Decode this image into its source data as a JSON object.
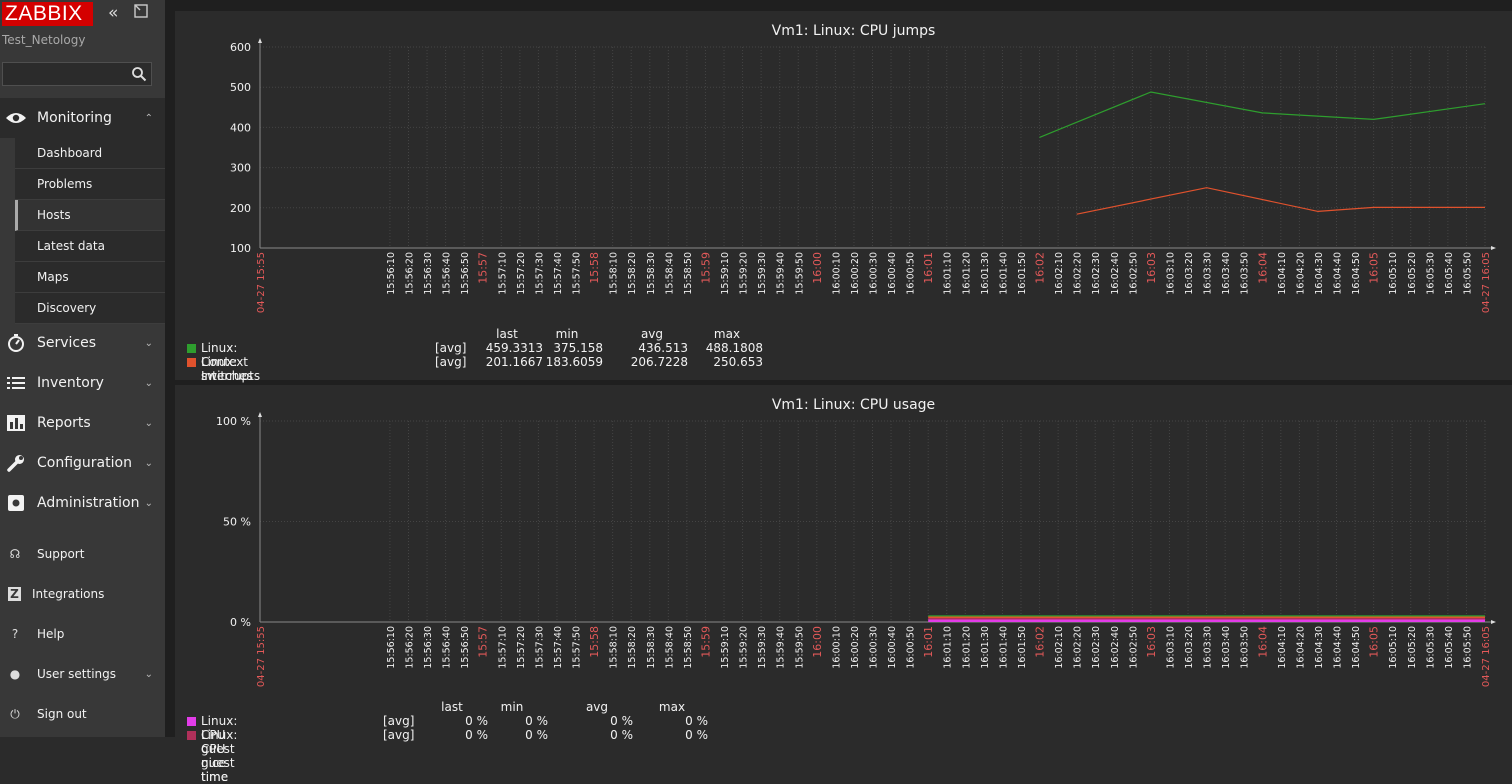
{
  "app": {
    "logo": "ZABBIX",
    "server_name": "Test_Netology",
    "search_placeholder": ""
  },
  "sidebar": {
    "monitoring": {
      "label": "Monitoring",
      "icon": "eye-icon"
    },
    "submenu": [
      {
        "label": "Dashboard",
        "active": false
      },
      {
        "label": "Problems",
        "active": false
      },
      {
        "label": "Hosts",
        "active": true
      },
      {
        "label": "Latest data",
        "active": false
      },
      {
        "label": "Maps",
        "active": false
      },
      {
        "label": "Discovery",
        "active": false
      }
    ],
    "sections": [
      {
        "label": "Services",
        "icon": "stopwatch-icon"
      },
      {
        "label": "Inventory",
        "icon": "list-icon"
      },
      {
        "label": "Reports",
        "icon": "bar-chart-icon"
      },
      {
        "label": "Configuration",
        "icon": "wrench-icon"
      },
      {
        "label": "Administration",
        "icon": "gear-icon"
      }
    ],
    "bottom": [
      {
        "label": "Support",
        "icon": "headset-icon",
        "glyph": "☊"
      },
      {
        "label": "Integrations",
        "icon": "z-icon",
        "glyph": "Z"
      },
      {
        "label": "Help",
        "icon": "question-icon",
        "glyph": "?"
      },
      {
        "label": "User settings",
        "icon": "user-icon",
        "glyph": "●"
      },
      {
        "label": "Sign out",
        "icon": "power-icon",
        "glyph": "⏻"
      }
    ]
  },
  "colors": {
    "accent_red": "#d40000",
    "time_label_red": "#e45959",
    "series_green": "#2e9e2e",
    "series_orange": "#e0522d",
    "series_magenta": "#e23ce8"
  },
  "chart_data": [
    {
      "type": "line",
      "title": "Vm1: Linux: CPU jumps",
      "ylim": [
        100,
        600
      ],
      "y_ticks": [
        "600",
        "500",
        "400",
        "300",
        "200",
        "100"
      ],
      "x_start_label": "04-27 15:55",
      "x_end_label": "04-27 16:05",
      "x_tick_labels": [
        "15:56:10",
        "15:56:20",
        "15:56:30",
        "15:56:40",
        "15:56:50",
        "15:57",
        "15:57:10",
        "15:57:20",
        "15:57:30",
        "15:57:40",
        "15:57:50",
        "15:58",
        "15:58:10",
        "15:58:20",
        "15:58:30",
        "15:58:40",
        "15:58:50",
        "15:59",
        "15:59:10",
        "15:59:20",
        "15:59:30",
        "15:59:40",
        "15:59:50",
        "16:00",
        "16:00:10",
        "16:00:20",
        "16:00:30",
        "16:00:40",
        "16:00:50",
        "16:01",
        "16:01:10",
        "16:01:20",
        "16:01:30",
        "16:01:40",
        "16:01:50",
        "16:02",
        "16:02:10",
        "16:02:20",
        "16:02:30",
        "16:02:40",
        "16:02:50",
        "16:03",
        "16:03:10",
        "16:03:20",
        "16:03:30",
        "16:03:40",
        "16:03:50",
        "16:04",
        "16:04:10",
        "16:04:20",
        "16:04:30",
        "16:04:40",
        "16:04:50",
        "16:05",
        "16:05:10",
        "16:05:20",
        "16:05:30",
        "16:05:40",
        "16:05:50"
      ],
      "grid": true,
      "series": [
        {
          "name": "Linux: Context switches per second",
          "func": "[avg]",
          "color": "#2e9e2e",
          "x": [
            "16:02",
            "16:03",
            "16:04",
            "16:05",
            "16:06"
          ],
          "values": [
            375,
            488,
            436,
            420,
            459
          ],
          "last": "459.3313",
          "min": "375.158",
          "avg": "436.513",
          "max": "488.1808"
        },
        {
          "name": "Linux: Interrupts per second",
          "func": "[avg]",
          "color": "#e0522d",
          "x": [
            "16:02:20",
            "16:03:30",
            "16:04:30",
            "16:05",
            "16:06"
          ],
          "values": [
            184,
            250,
            191,
            201,
            201
          ],
          "last": "201.1667",
          "min": "183.6059",
          "avg": "206.7228",
          "max": "250.653"
        }
      ],
      "legend_headers": [
        "last",
        "min",
        "avg",
        "max"
      ]
    },
    {
      "type": "area",
      "title": "Vm1: Linux: CPU usage",
      "ylim": [
        0,
        100
      ],
      "y_ticks": [
        "100 %",
        "50 %",
        "0 %"
      ],
      "x_start_label": "04-27 15:55",
      "x_end_label": "04-27 16:05",
      "grid": true,
      "series": [
        {
          "name": "Linux: CPU guest nice time",
          "func": "[avg]",
          "color": "#e23ce8",
          "last": "0 %",
          "min": "0 %",
          "avg": "0 %",
          "max": "0 %"
        },
        {
          "name": "Linux: CPU guest time",
          "func": "[avg]",
          "color": "#b0305a",
          "last": "0 %",
          "min": "0 %",
          "avg": "0 %",
          "max": "0 %"
        }
      ],
      "legend_headers": [
        "last",
        "min",
        "avg",
        "max"
      ]
    }
  ]
}
